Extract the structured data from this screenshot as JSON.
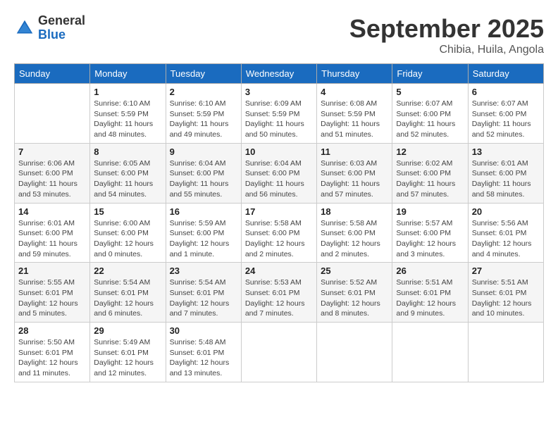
{
  "header": {
    "logo_general": "General",
    "logo_blue": "Blue",
    "month_title": "September 2025",
    "subtitle": "Chibia, Huila, Angola"
  },
  "weekdays": [
    "Sunday",
    "Monday",
    "Tuesday",
    "Wednesday",
    "Thursday",
    "Friday",
    "Saturday"
  ],
  "weeks": [
    [
      {
        "day": "",
        "detail": ""
      },
      {
        "day": "1",
        "detail": "Sunrise: 6:10 AM\nSunset: 5:59 PM\nDaylight: 11 hours\nand 48 minutes."
      },
      {
        "day": "2",
        "detail": "Sunrise: 6:10 AM\nSunset: 5:59 PM\nDaylight: 11 hours\nand 49 minutes."
      },
      {
        "day": "3",
        "detail": "Sunrise: 6:09 AM\nSunset: 5:59 PM\nDaylight: 11 hours\nand 50 minutes."
      },
      {
        "day": "4",
        "detail": "Sunrise: 6:08 AM\nSunset: 5:59 PM\nDaylight: 11 hours\nand 51 minutes."
      },
      {
        "day": "5",
        "detail": "Sunrise: 6:07 AM\nSunset: 6:00 PM\nDaylight: 11 hours\nand 52 minutes."
      },
      {
        "day": "6",
        "detail": "Sunrise: 6:07 AM\nSunset: 6:00 PM\nDaylight: 11 hours\nand 52 minutes."
      }
    ],
    [
      {
        "day": "7",
        "detail": "Sunrise: 6:06 AM\nSunset: 6:00 PM\nDaylight: 11 hours\nand 53 minutes."
      },
      {
        "day": "8",
        "detail": "Sunrise: 6:05 AM\nSunset: 6:00 PM\nDaylight: 11 hours\nand 54 minutes."
      },
      {
        "day": "9",
        "detail": "Sunrise: 6:04 AM\nSunset: 6:00 PM\nDaylight: 11 hours\nand 55 minutes."
      },
      {
        "day": "10",
        "detail": "Sunrise: 6:04 AM\nSunset: 6:00 PM\nDaylight: 11 hours\nand 56 minutes."
      },
      {
        "day": "11",
        "detail": "Sunrise: 6:03 AM\nSunset: 6:00 PM\nDaylight: 11 hours\nand 57 minutes."
      },
      {
        "day": "12",
        "detail": "Sunrise: 6:02 AM\nSunset: 6:00 PM\nDaylight: 11 hours\nand 57 minutes."
      },
      {
        "day": "13",
        "detail": "Sunrise: 6:01 AM\nSunset: 6:00 PM\nDaylight: 11 hours\nand 58 minutes."
      }
    ],
    [
      {
        "day": "14",
        "detail": "Sunrise: 6:01 AM\nSunset: 6:00 PM\nDaylight: 11 hours\nand 59 minutes."
      },
      {
        "day": "15",
        "detail": "Sunrise: 6:00 AM\nSunset: 6:00 PM\nDaylight: 12 hours\nand 0 minutes."
      },
      {
        "day": "16",
        "detail": "Sunrise: 5:59 AM\nSunset: 6:00 PM\nDaylight: 12 hours\nand 1 minute."
      },
      {
        "day": "17",
        "detail": "Sunrise: 5:58 AM\nSunset: 6:00 PM\nDaylight: 12 hours\nand 2 minutes."
      },
      {
        "day": "18",
        "detail": "Sunrise: 5:58 AM\nSunset: 6:00 PM\nDaylight: 12 hours\nand 2 minutes."
      },
      {
        "day": "19",
        "detail": "Sunrise: 5:57 AM\nSunset: 6:00 PM\nDaylight: 12 hours\nand 3 minutes."
      },
      {
        "day": "20",
        "detail": "Sunrise: 5:56 AM\nSunset: 6:01 PM\nDaylight: 12 hours\nand 4 minutes."
      }
    ],
    [
      {
        "day": "21",
        "detail": "Sunrise: 5:55 AM\nSunset: 6:01 PM\nDaylight: 12 hours\nand 5 minutes."
      },
      {
        "day": "22",
        "detail": "Sunrise: 5:54 AM\nSunset: 6:01 PM\nDaylight: 12 hours\nand 6 minutes."
      },
      {
        "day": "23",
        "detail": "Sunrise: 5:54 AM\nSunset: 6:01 PM\nDaylight: 12 hours\nand 7 minutes."
      },
      {
        "day": "24",
        "detail": "Sunrise: 5:53 AM\nSunset: 6:01 PM\nDaylight: 12 hours\nand 7 minutes."
      },
      {
        "day": "25",
        "detail": "Sunrise: 5:52 AM\nSunset: 6:01 PM\nDaylight: 12 hours\nand 8 minutes."
      },
      {
        "day": "26",
        "detail": "Sunrise: 5:51 AM\nSunset: 6:01 PM\nDaylight: 12 hours\nand 9 minutes."
      },
      {
        "day": "27",
        "detail": "Sunrise: 5:51 AM\nSunset: 6:01 PM\nDaylight: 12 hours\nand 10 minutes."
      }
    ],
    [
      {
        "day": "28",
        "detail": "Sunrise: 5:50 AM\nSunset: 6:01 PM\nDaylight: 12 hours\nand 11 minutes."
      },
      {
        "day": "29",
        "detail": "Sunrise: 5:49 AM\nSunset: 6:01 PM\nDaylight: 12 hours\nand 12 minutes."
      },
      {
        "day": "30",
        "detail": "Sunrise: 5:48 AM\nSunset: 6:01 PM\nDaylight: 12 hours\nand 13 minutes."
      },
      {
        "day": "",
        "detail": ""
      },
      {
        "day": "",
        "detail": ""
      },
      {
        "day": "",
        "detail": ""
      },
      {
        "day": "",
        "detail": ""
      }
    ]
  ]
}
